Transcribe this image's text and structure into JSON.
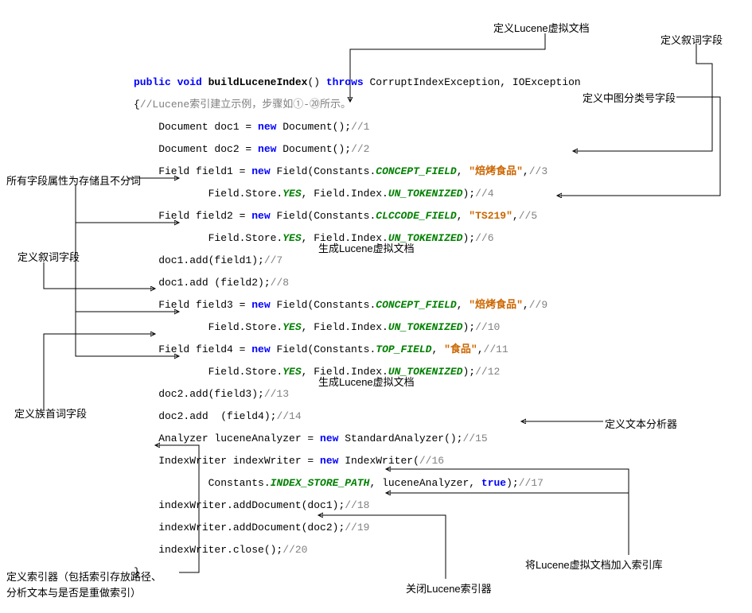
{
  "anno": {
    "top1": "定义Lucene虚拟文档",
    "top2": "定义叙词字段",
    "top3": "定义中图分类号字段",
    "left1": "所有字段属性为存储且不分词",
    "left2": "定义叙词字段",
    "left3": "定义族首词字段",
    "mid1": "生成Lucene虚拟文档",
    "mid2": "生成Lucene虚拟文档",
    "right1": "定义文本分析器",
    "bot1": "将Lucene虚拟文档加入索引库",
    "bot2": "关闭Lucene索引器",
    "bot3a": "定义索引器（包括索引存放路径、",
    "bot3b": "      分析文本与是否是重做索引）"
  },
  "code": {
    "sig_pre": "public void ",
    "sig_fn": "buildLuceneIndex",
    "sig_mid": "() ",
    "sig_throws": "throws",
    "sig_exc": " CorruptIndexException, IOException",
    "l0": "{",
    "l0cmt": "//Lucene索引建立示例，步骤如①-⑳所示。",
    "l1a": "    Document doc1 = ",
    "l1b": " Document();",
    "l1c": "//1",
    "l2a": "    Document doc2 = ",
    "l2b": " Document();",
    "l2c": "//2",
    "l3a": "    Field field1 = ",
    "l3b": " Field(Constants.",
    "l3c": "CONCEPT_FIELD",
    "l3d": ", ",
    "l3e": "\"焙烤食品\"",
    "l3f": ",",
    "l3g": "//3",
    "l4a": "            Field.Store.",
    "l4b": "YES",
    "l4c": ", Field.Index.",
    "l4d": "UN_TOKENIZED",
    "l4e": ");",
    "l4f": "//4",
    "l5a": "    Field field2 = ",
    "l5b": " Field(Constants.",
    "l5c": "CLCCODE_FIELD",
    "l5d": ", ",
    "l5e": "\"TS219\"",
    "l5f": ",",
    "l5g": "//5",
    "l6a": "            Field.Store.",
    "l6e": ");",
    "l6f": "//6",
    "l7a": "    doc1.add(field1);",
    "l7b": "//7",
    "l8a": "    doc1.add (field2);",
    "l8b": "//8",
    "l9a": "    Field field3 = ",
    "l9b": " Field(Constants.",
    "l9c": "CONCEPT_FIELD",
    "l9e": "\"焙烤食品\"",
    "l9g": "//9",
    "l10f": "//10",
    "l11a": "    Field field4 = ",
    "l11b": " Field(Constants.",
    "l11c": "TOP_FIELD",
    "l11e": "\"食品\"",
    "l11g": "//11",
    "l12f": "//12",
    "l13a": "    doc2.add(field3);",
    "l13b": "//13",
    "l14a": "    doc2.add  (field4);",
    "l14b": "//14",
    "l15a": "    Analyzer luceneAnalyzer = ",
    "l15b": " StandardAnalyzer();",
    "l15c": "//15",
    "l16a": "    IndexWriter indexWriter = ",
    "l16b": " IndexWriter(",
    "l16c": "//16",
    "l17a": "            Constants.",
    "l17b": "INDEX_STORE_PATH",
    "l17c": ", luceneAnalyzer, ",
    "l17d": "true",
    "l17e": ");",
    "l17f": "//17",
    "l18a": "    indexWriter.addDocument(doc1);",
    "l18b": "//18",
    "l19a": "    indexWriter.addDocument(doc2);",
    "l19b": "//19",
    "l20a": "    indexWriter.close();",
    "l20b": "//20",
    "new": "new",
    "rbrace": "}"
  }
}
